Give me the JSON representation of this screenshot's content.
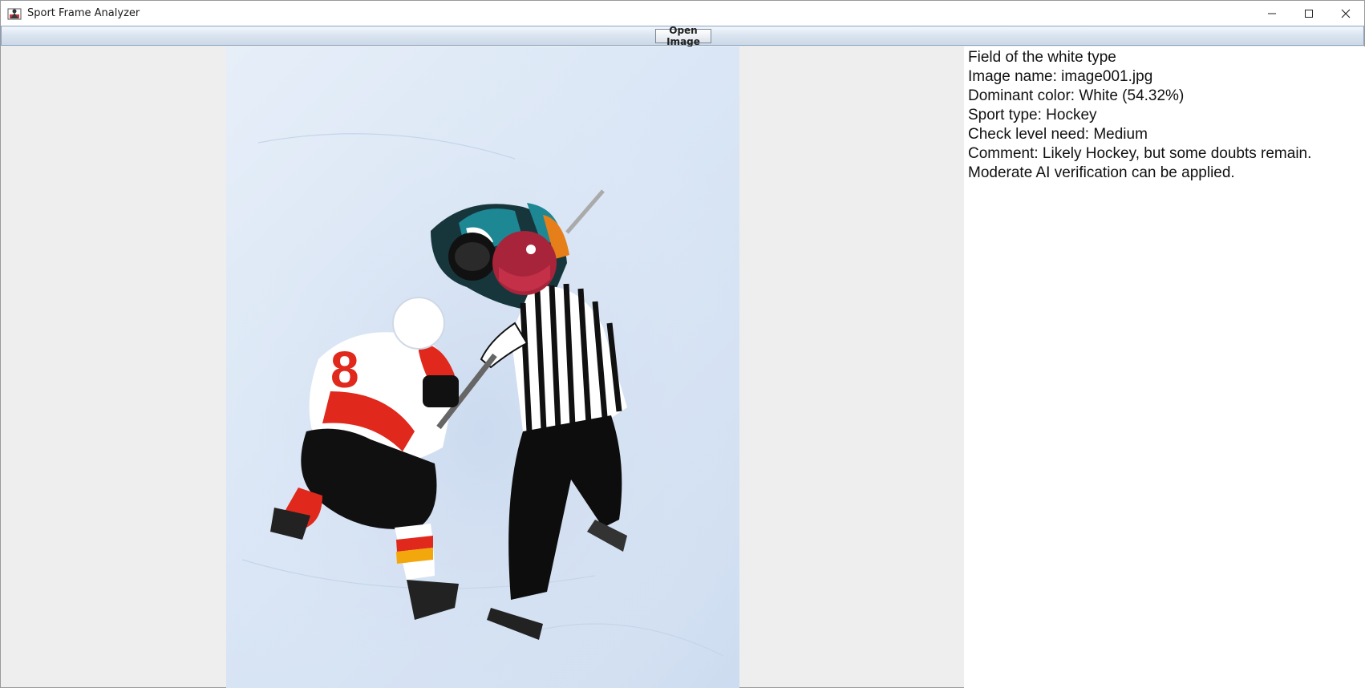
{
  "window": {
    "title": "Sport Frame Analyzer",
    "controls": [
      "minimize-icon",
      "maximize-icon",
      "close-icon"
    ]
  },
  "toolbar": {
    "open_label": "Open Image"
  },
  "image": {
    "subject": "hockey-faceoff-photo"
  },
  "info": {
    "lines": [
      "Field of the white type",
      "Image name: image001.jpg",
      "Dominant color: White (54.32%)",
      "Sport type: Hockey",
      "Check level need: Medium",
      "Comment: Likely Hockey, but some doubts remain.",
      "Moderate AI verification can be applied."
    ]
  },
  "colors": {
    "ice": "#dbe7f6",
    "jersey_red": "#e0281c",
    "helmet_red": "#b3243a",
    "jersey_teal": "#1e7f8c",
    "toolbar_blue": "#d9e4f0"
  }
}
